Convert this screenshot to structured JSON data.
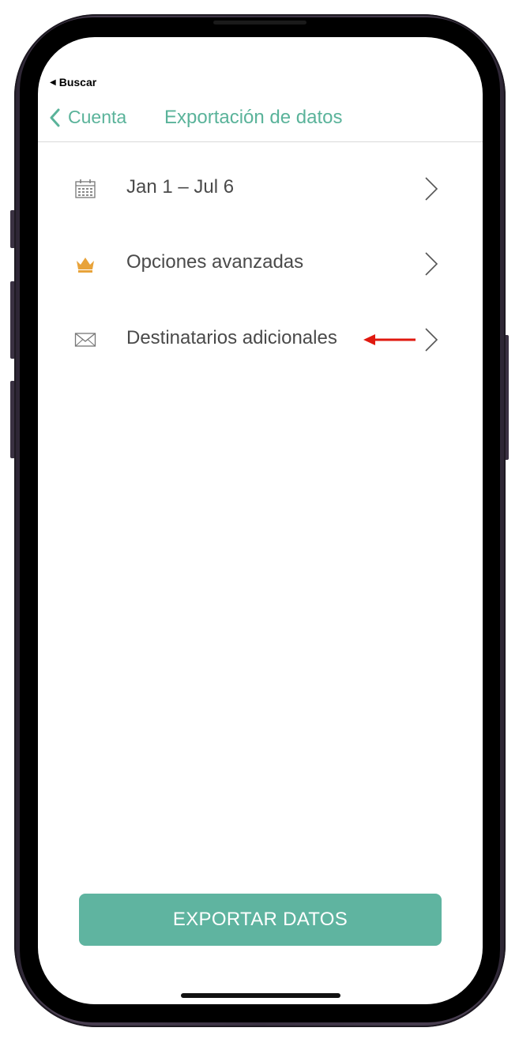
{
  "status_bar": {
    "back_arrow": "◀",
    "back_label": "Buscar"
  },
  "navbar": {
    "back_label": "Cuenta",
    "title": "Exportación de datos"
  },
  "rows": [
    {
      "icon": "calendar-icon",
      "label": "Jan 1 – Jul 6"
    },
    {
      "icon": "crown-icon",
      "label": "Opciones avanzadas"
    },
    {
      "icon": "envelope-icon",
      "label": "Destinatarios adicionales"
    }
  ],
  "export_button": {
    "label": "EXPORTAR DATOS"
  },
  "colors": {
    "accent": "#5ab39a",
    "button": "#5fb4a0",
    "crown": "#e8a33a",
    "annotation_arrow": "#e0190f"
  }
}
